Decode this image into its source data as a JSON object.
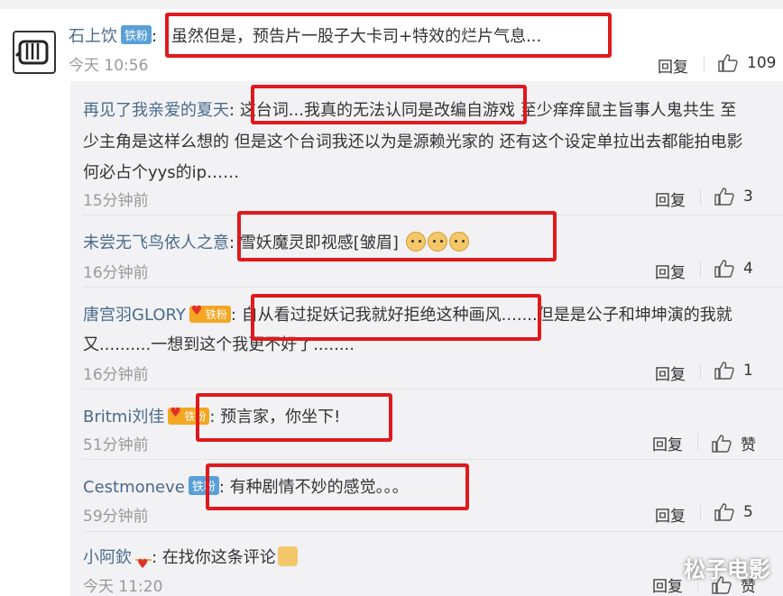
{
  "main": {
    "user": "石上饮",
    "badge": "铁粉",
    "text": "虽然但是，预告片一股子大卡司+特效的烂片气息...",
    "time": "今天 10:56",
    "reply_label": "回复",
    "likes": "109"
  },
  "replies": [
    {
      "user": "再见了我亲爱的夏天",
      "badge": "",
      "line1": "这台词...我真的无法认同是改编自游戏 至少痒痒鼠主旨事人鬼共生 至",
      "line2": "少主角是这样么想的 但是这个台词我还以为是源赖光家的 还有这个设定单拉出去都能拍电影",
      "line3": "何必占个yys的ip……",
      "time": "15分钟前",
      "reply_label": "回复",
      "likes": "3"
    },
    {
      "user": "未尝无飞鸟依人之意",
      "badge": "",
      "line1": "雪妖魔灵即视感[皱眉]",
      "time": "16分钟前",
      "reply_label": "回复",
      "likes": "4"
    },
    {
      "user": "唐宫羽GLORY",
      "badge": "铁粉",
      "line1": "自从看过捉妖记我就好拒绝这种画风.......但是是公子和坤坤演的我就",
      "line2": "又..........一想到这个我更不好了........",
      "time": "16分钟前",
      "reply_label": "回复",
      "likes": "1"
    },
    {
      "user": "Britmi刘佳",
      "badge": "铁粉",
      "line1": "预言家，你坐下!",
      "time": "51分钟前",
      "reply_label": "回复",
      "likes": "赞"
    },
    {
      "user": "Cestmoneve",
      "badge": "铁粉",
      "line1": "有种剧情不妙的感觉。。。",
      "time": "59分钟前",
      "reply_label": "回复",
      "likes": "5"
    },
    {
      "user": "小阿欽",
      "badge": "",
      "line1": "在找你这条评论",
      "time": "今天 11:20",
      "reply_label": "回复",
      "likes": "赞"
    }
  ],
  "watermark": "松子电影",
  "colors": {
    "highlight": "#e0191c",
    "link": "#4a6a8a",
    "badge_blue": "#5aa0d8",
    "badge_gold": "#f5a623"
  }
}
